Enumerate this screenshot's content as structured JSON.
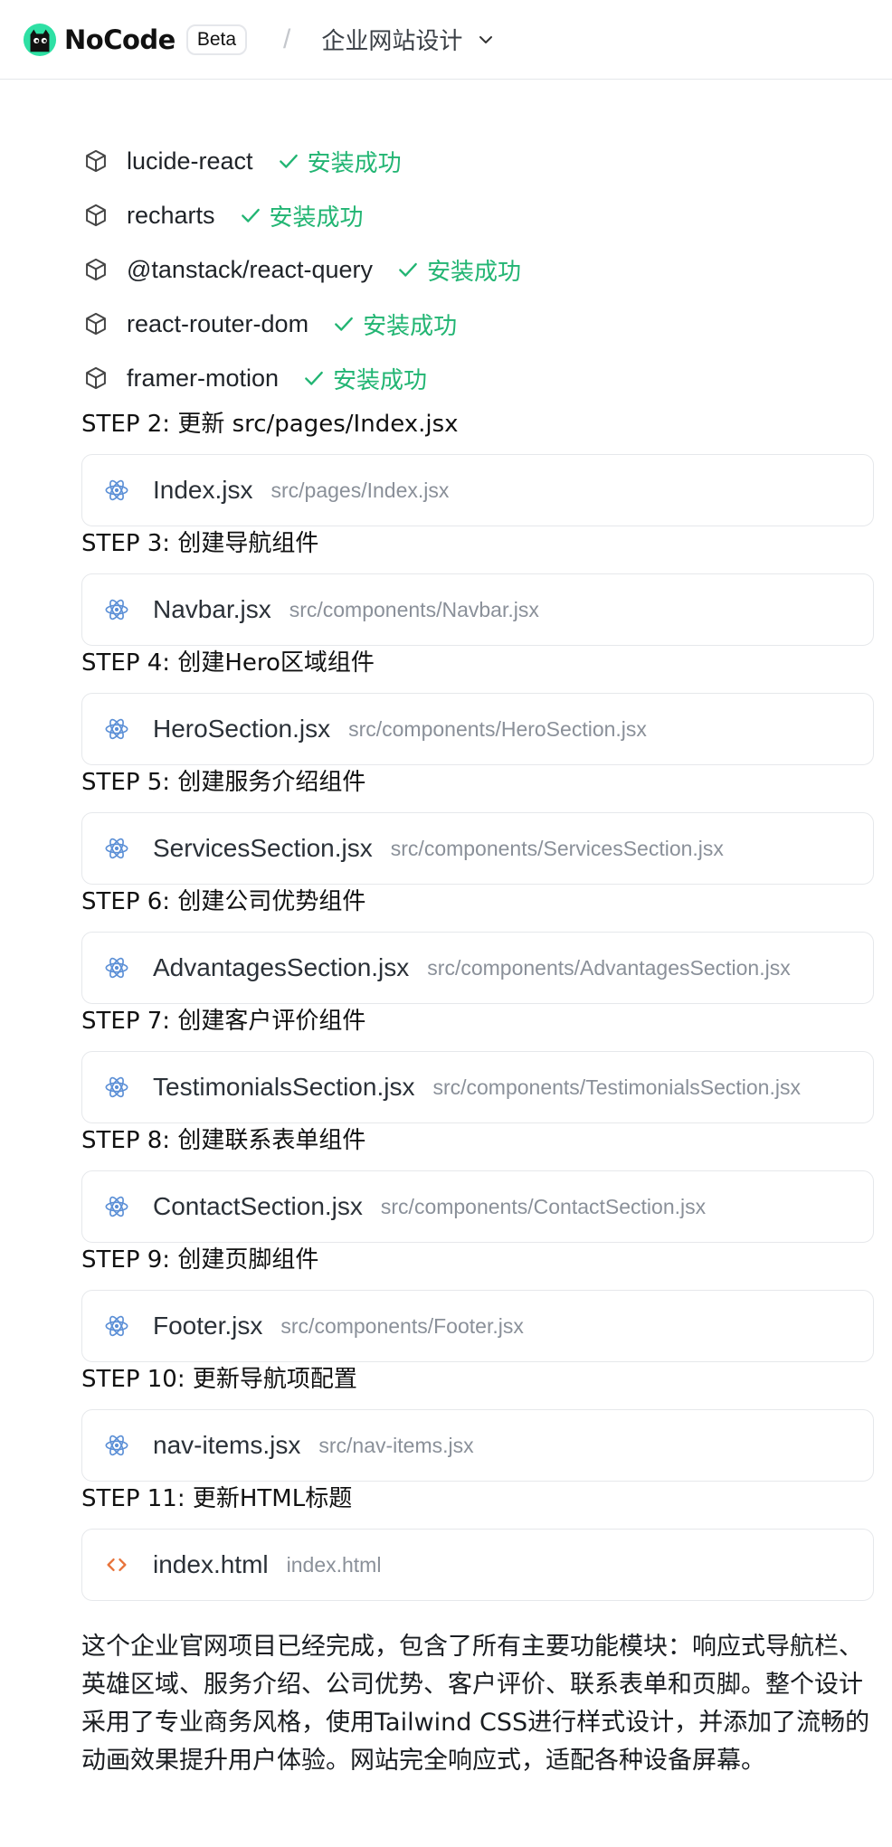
{
  "header": {
    "brand": "NoCode",
    "badge": "Beta",
    "separator": "/",
    "project_title": "企业网站设计"
  },
  "dependencies": [
    {
      "name": "lucide-react",
      "status": "安装成功"
    },
    {
      "name": "recharts",
      "status": "安装成功"
    },
    {
      "name": "@tanstack/react-query",
      "status": "安装成功"
    },
    {
      "name": "react-router-dom",
      "status": "安装成功"
    },
    {
      "name": "framer-motion",
      "status": "安装成功"
    }
  ],
  "steps": [
    {
      "title": "STEP 2: 更新 src/pages/Index.jsx",
      "file": "Index.jsx",
      "path": "src/pages/Index.jsx",
      "icon": "react-icon"
    },
    {
      "title": "STEP 3: 创建导航组件",
      "file": "Navbar.jsx",
      "path": "src/components/Navbar.jsx",
      "icon": "react-icon"
    },
    {
      "title": "STEP 4: 创建Hero区域组件",
      "file": "HeroSection.jsx",
      "path": "src/components/HeroSection.jsx",
      "icon": "react-icon"
    },
    {
      "title": "STEP 5: 创建服务介绍组件",
      "file": "ServicesSection.jsx",
      "path": "src/components/ServicesSection.jsx",
      "icon": "react-icon"
    },
    {
      "title": "STEP 6: 创建公司优势组件",
      "file": "AdvantagesSection.jsx",
      "path": "src/components/AdvantagesSection.jsx",
      "icon": "react-icon"
    },
    {
      "title": "STEP 7: 创建客户评价组件",
      "file": "TestimonialsSection.jsx",
      "path": "src/components/TestimonialsSection.jsx",
      "icon": "react-icon"
    },
    {
      "title": "STEP 8: 创建联系表单组件",
      "file": "ContactSection.jsx",
      "path": "src/components/ContactSection.jsx",
      "icon": "react-icon"
    },
    {
      "title": "STEP 9: 创建页脚组件",
      "file": "Footer.jsx",
      "path": "src/components/Footer.jsx",
      "icon": "react-icon"
    },
    {
      "title": "STEP 10: 更新导航项配置",
      "file": "nav-items.jsx",
      "path": "src/nav-items.jsx",
      "icon": "react-icon"
    },
    {
      "title": "STEP 11: 更新HTML标题",
      "file": "index.html",
      "path": "index.html",
      "icon": "html-code-icon"
    }
  ],
  "summary": "这个企业官网项目已经完成，包含了所有主要功能模块：响应式导航栏、英雄区域、服务介绍、公司优势、客户评价、联系表单和页脚。整个设计采用了专业商务风格，使用Tailwind CSS进行样式设计，并添加了流畅的动画效果提升用户体验。网站完全响应式，适配各种设备屏幕。",
  "colors": {
    "success": "#22b573",
    "react_icon": "#5b8fd6",
    "html_icon": "#e8733a",
    "logo_bg": "#2ee0a4"
  }
}
